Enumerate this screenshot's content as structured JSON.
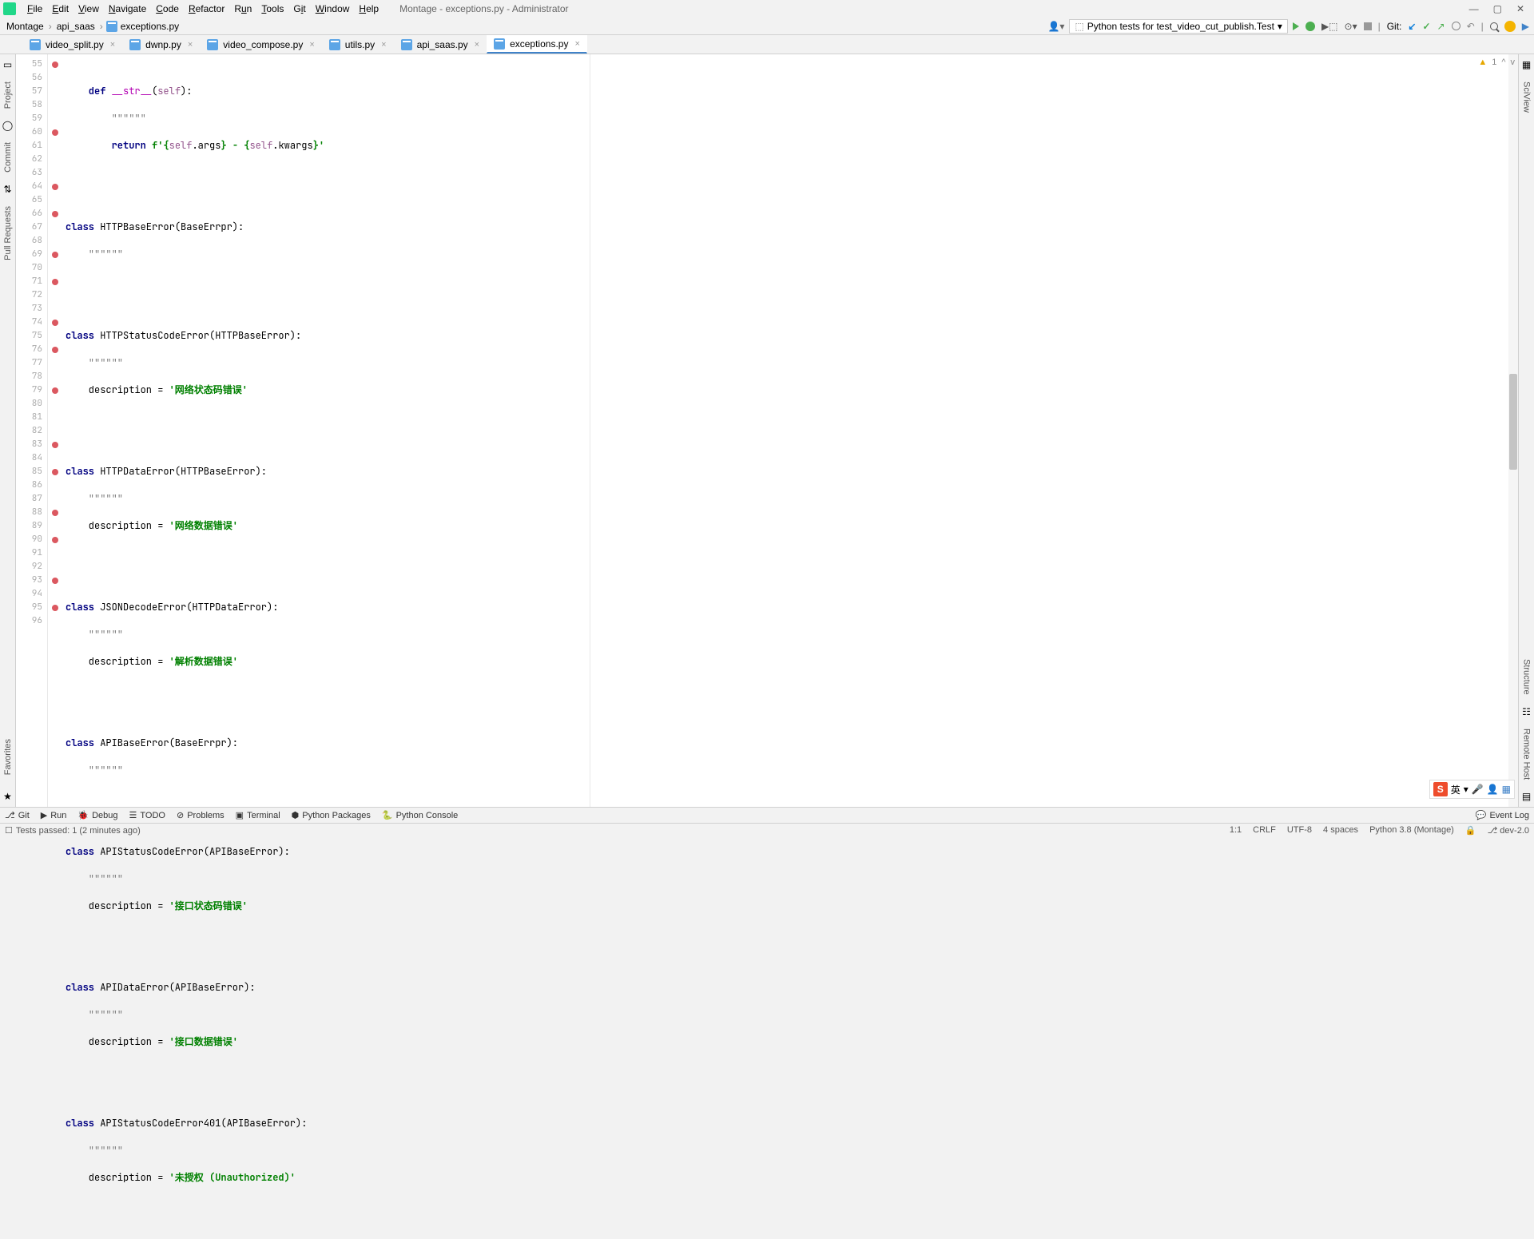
{
  "window": {
    "title": "Montage - exceptions.py - Administrator"
  },
  "menu": {
    "file": "File",
    "edit": "Edit",
    "view": "View",
    "navigate": "Navigate",
    "code": "Code",
    "refactor": "Refactor",
    "run": "Run",
    "tools": "Tools",
    "git": "Git",
    "window": "Window",
    "help": "Help"
  },
  "breadcrumbs": {
    "p0": "Montage",
    "p1": "api_saas",
    "p2": "exceptions.py"
  },
  "run_config": {
    "label": "Python tests for test_video_cut_publish.Test"
  },
  "git_label": "Git:",
  "tabs": {
    "t0": "video_split.py",
    "t1": "dwnp.py",
    "t2": "video_compose.py",
    "t3": "utils.py",
    "t4": "api_saas.py",
    "t5": "exceptions.py"
  },
  "left_rail": {
    "project": "Project",
    "commit": "Commit",
    "pull": "Pull Requests"
  },
  "right_rail": {
    "sciview": "SciView",
    "structure": "Structure",
    "remote": "Remote Host",
    "favorites": "Favorites"
  },
  "gutter": {
    "l55": "55",
    "l56": "56",
    "l57": "57",
    "l58": "58",
    "l59": "59",
    "l60": "60",
    "l61": "61",
    "l62": "62",
    "l63": "63",
    "l64": "64",
    "l65": "65",
    "l66": "66",
    "l67": "67",
    "l68": "68",
    "l69": "69",
    "l70": "70",
    "l71": "71",
    "l72": "72",
    "l73": "73",
    "l74": "74",
    "l75": "75",
    "l76": "76",
    "l77": "77",
    "l78": "78",
    "l79": "79",
    "l80": "80",
    "l81": "81",
    "l82": "82",
    "l83": "83",
    "l84": "84",
    "l85": "85",
    "l86": "86",
    "l87": "87",
    "l88": "88",
    "l89": "89",
    "l90": "90",
    "l91": "91",
    "l92": "92",
    "l93": "93",
    "l94": "94",
    "l95": "95",
    "l96": "96"
  },
  "code": {
    "l55_def": "    def ",
    "l55_dunder": "__str__",
    "l55_rest1": "(",
    "l55_self": "self",
    "l55_rest2": "):",
    "l56_doc": "        \"\"\"\"\"\"",
    "l57_ret": "        return ",
    "l57_f": "f'",
    "l57_b1": "{",
    "l57_self1": "self",
    "l57_args": ".args",
    "l57_b2": "}",
    "l57_mid": " - ",
    "l57_b3": "{",
    "l57_self2": "self",
    "l57_kw": ".kwargs",
    "l57_b4": "}",
    "l57_end": "'",
    "l60_class": "class ",
    "l60_name": "HTTPBaseError(BaseErrpr):",
    "l61_doc": "    \"\"\"\"\"\"",
    "l64_class": "class ",
    "l64_name": "HTTPStatusCodeError(HTTPBaseError):",
    "l65_doc": "    \"\"\"\"\"\"",
    "l66_desc": "    description = ",
    "l66_str": "'网络状态码错误'",
    "l69_class": "class ",
    "l69_name": "HTTPDataError(HTTPBaseError):",
    "l70_doc": "    \"\"\"\"\"\"",
    "l71_desc": "    description = ",
    "l71_str": "'网络数据错误'",
    "l74_class": "class ",
    "l74_name": "JSONDecodeError(HTTPDataError):",
    "l75_doc": "    \"\"\"\"\"\"",
    "l76_desc": "    description = ",
    "l76_str": "'解析数据错误'",
    "l79_class": "class ",
    "l79_name": "APIBaseError(BaseErrpr):",
    "l80_doc": "    \"\"\"\"\"\"",
    "l83_class": "class ",
    "l83_name": "APIStatusCodeError(APIBaseError):",
    "l84_doc": "    \"\"\"\"\"\"",
    "l85_desc": "    description = ",
    "l85_str": "'接口状态码错误'",
    "l88_class": "class ",
    "l88_name": "APIDataError(APIBaseError):",
    "l89_doc": "    \"\"\"\"\"\"",
    "l90_desc": "    description = ",
    "l90_str": "'接口数据错误'",
    "l93_class": "class ",
    "l93_name": "APIStatusCodeError401(APIBaseError):",
    "l94_doc": "    \"\"\"\"\"\"",
    "l95_desc": "    description = ",
    "l95_str": "'未授权 (Unauthorized)'"
  },
  "inspect": {
    "warn_count": "1",
    "up": "^",
    "down": "v"
  },
  "ime": {
    "s": "S",
    "lang": "英"
  },
  "tool_windows": {
    "git": "Git",
    "run": "Run",
    "debug": "Debug",
    "todo": "TODO",
    "problems": "Problems",
    "terminal": "Terminal",
    "pypkg": "Python Packages",
    "pyconsole": "Python Console",
    "eventlog": "Event Log"
  },
  "status": {
    "left": "Tests passed: 1 (2 minutes ago)",
    "pos": "1:1",
    "sep": "CRLF",
    "enc": "UTF-8",
    "indent": "4 spaces",
    "interp": "Python 3.8 (Montage)",
    "branch": "dev-2.0"
  }
}
